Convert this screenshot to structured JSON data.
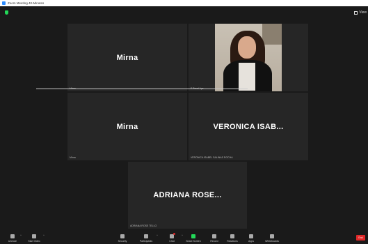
{
  "window": {
    "title": "Zoom Meeting 40-Minutes"
  },
  "tiles": [
    {
      "big_name": "Mirna",
      "label": "Mirna"
    },
    {
      "big_name": "",
      "label": "F Pecel Aps"
    },
    {
      "big_name": "Mirna",
      "label": "Mirna"
    },
    {
      "big_name": "VERONICA ISAB...",
      "label": "VERONICA ISABEL SALINAS ROCHA"
    },
    {
      "big_name": "ADRIANA ROSE...",
      "label": "ADRIANA ROSE TELLO"
    }
  ],
  "view": {
    "label": "View"
  },
  "toolbar": {
    "unmute": "Unmute",
    "start_video": "Start Video",
    "security": "Security",
    "participants": "Participants",
    "participants_count": "9",
    "chat": "Chat",
    "share_screen": "Share Screen",
    "record": "Record",
    "reactions": "Reactions",
    "apps": "Apps",
    "whiteboards": "Whiteboards",
    "end": "End"
  }
}
